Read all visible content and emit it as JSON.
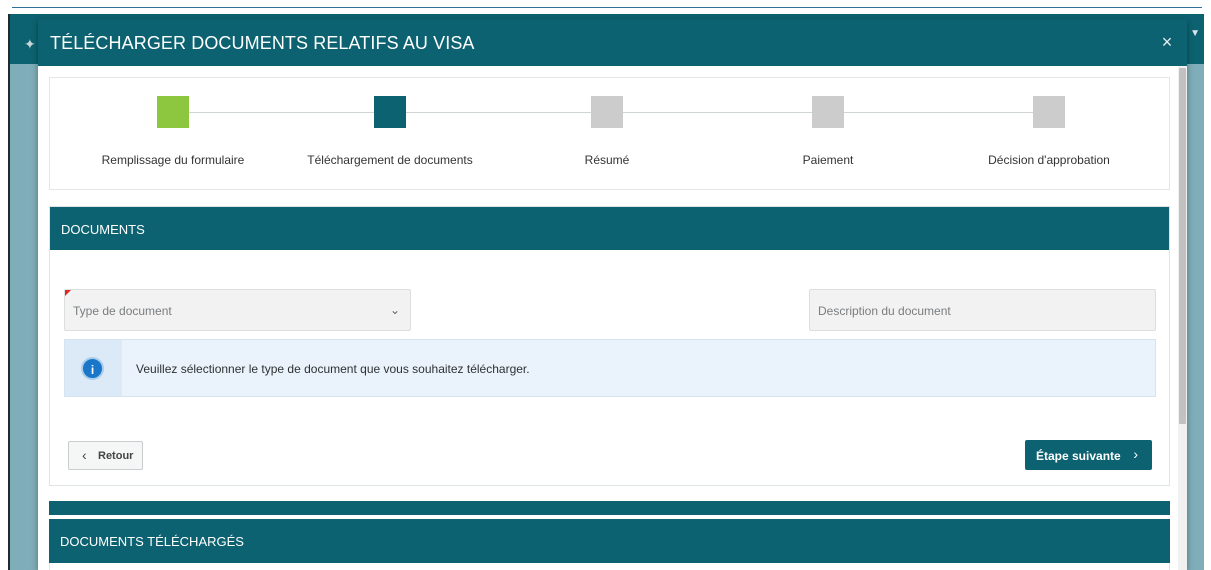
{
  "modal": {
    "title": "TÉLÉCHARGER DOCUMENTS RELATIFS AU VISA",
    "close_glyph": "×"
  },
  "steps": [
    {
      "label": "Remplissage du formulaire",
      "color": "#8dc63f"
    },
    {
      "label": "Téléchargement de documents",
      "color": "#0c6270"
    },
    {
      "label": "Résumé",
      "color": "#cccccc"
    },
    {
      "label": "Paiement",
      "color": "#cccccc"
    },
    {
      "label": "Décision d'approbation",
      "color": "#cccccc"
    }
  ],
  "documents": {
    "header": "DOCUMENTS",
    "type_select": {
      "value": "Type de document",
      "chevron": "⌄"
    },
    "description_placeholder": "Description du document",
    "info_message": "Veuillez sélectionner le type de document que vous souhaitez télécharger.",
    "info_glyph": "i"
  },
  "nav": {
    "back_label": "Retour",
    "back_glyph": "‹",
    "next_label": "Étape suivante",
    "next_glyph": "›"
  },
  "uploaded": {
    "header": "DOCUMENTS TÉLÉCHARGÉS"
  },
  "colors": {
    "primary": "#0c6270",
    "step_done": "#8dc63f",
    "step_pending": "#cccccc",
    "info_icon": "#1976c9"
  }
}
